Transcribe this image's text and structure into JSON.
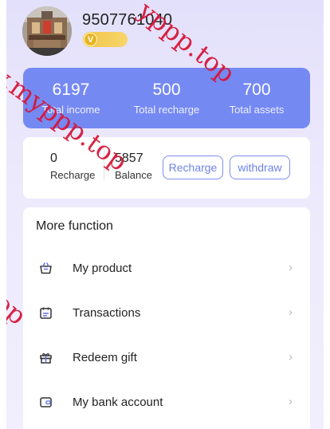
{
  "user": {
    "phone": "9507761040",
    "badge_icon": "check-coin-icon",
    "badge_mark": "V"
  },
  "stats": [
    {
      "value": "6197",
      "label": "Total income"
    },
    {
      "value": "500",
      "label": "Total recharge"
    },
    {
      "value": "700",
      "label": "Total assets"
    }
  ],
  "balance": {
    "recharge_value": "0",
    "recharge_label": "Recharge",
    "balance_value": "5857",
    "balance_label": "Balance",
    "recharge_button": "Recharge",
    "withdraw_button": "withdraw"
  },
  "functions": {
    "title": "More function",
    "items": [
      {
        "label": "My product",
        "icon": "basket-icon"
      },
      {
        "label": "Transactions",
        "icon": "calendar-icon"
      },
      {
        "label": "Redeem gift",
        "icon": "gift-icon"
      },
      {
        "label": "My bank account",
        "icon": "wallet-icon"
      }
    ],
    "chevron": "›"
  },
  "watermark": {
    "text_1": "w.myppp.top",
    "text_2": "yppp.top",
    "text_3": "top"
  },
  "colors": {
    "accent": "#7589f3",
    "watermark": "#d6173a",
    "badge": "#f0c64a"
  }
}
